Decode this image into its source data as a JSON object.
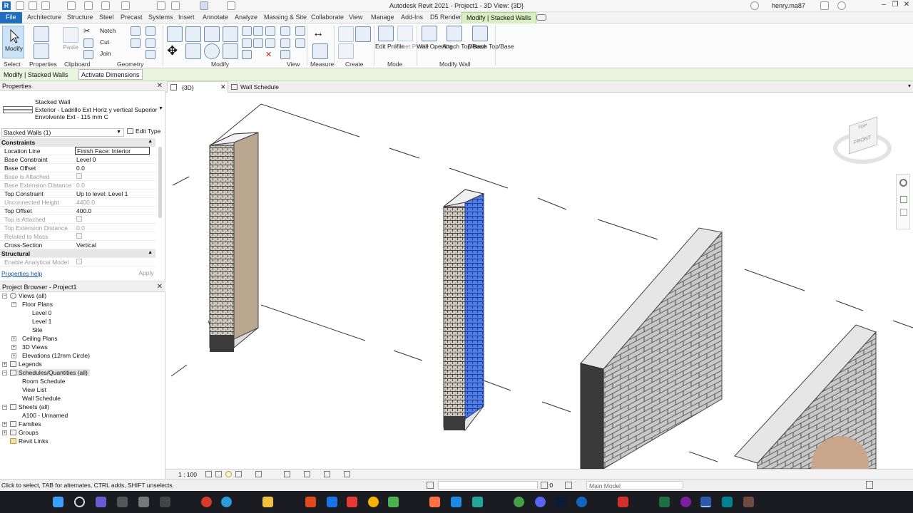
{
  "app": {
    "title": "Autodesk Revit 2021 - Project1 - 3D View: {3D}",
    "user": "henry.ma87"
  },
  "ribbon_tabs": [
    "File",
    "Architecture",
    "Structure",
    "Steel",
    "Precast",
    "Systems",
    "Insert",
    "Annotate",
    "Analyze",
    "Massing & Site",
    "Collaborate",
    "View",
    "Manage",
    "Add-Ins",
    "D5 Render",
    "Modify | Stacked Walls"
  ],
  "ribbon": {
    "modify": "Modify",
    "paste": "Paste",
    "notch": "Notch",
    "cut": "Cut",
    "join": "Join",
    "edit_profile": "Edit Profile",
    "reset_profile": "Reset Profile",
    "wall_opening": "Wall Opening",
    "attach": "Attach Top/Base",
    "detach": "Detach Top/Base",
    "groups": {
      "select": "Select",
      "properties": "Properties",
      "clipboard": "Clipboard",
      "geometry": "Geometry",
      "modify": "Modify",
      "view": "View",
      "measure": "Measure",
      "create": "Create",
      "mode": "Mode",
      "modify_wall": "Modify Wall"
    }
  },
  "context_bar": {
    "label": "Modify | Stacked Walls",
    "button": "Activate Dimensions"
  },
  "properties": {
    "header": "Properties",
    "type_family": "Stacked Wall",
    "type_name_1": "Exterior - Ladrillo Ext Horiz  y vertical Superior",
    "type_name_2": "Envolvente Ext - 115 mm C",
    "selector": "Stacked Walls (1)",
    "edit_type": "Edit Type",
    "help": "Properties help",
    "apply": "Apply",
    "section_constraints": "Constraints",
    "section_structural": "Structural",
    "rows": [
      {
        "key": "Location Line",
        "value": "Finish Face: Interior"
      },
      {
        "key": "Base Constraint",
        "value": "Level 0"
      },
      {
        "key": "Base Offset",
        "value": "0.0"
      },
      {
        "key": "Base is Attached",
        "value": ""
      },
      {
        "key": "Base Extension Distance",
        "value": "0.0"
      },
      {
        "key": "Top Constraint",
        "value": "Up to level: Level 1"
      },
      {
        "key": "Unconnected Height",
        "value": "4400.0"
      },
      {
        "key": "Top Offset",
        "value": "400.0"
      },
      {
        "key": "Top is Attached",
        "value": ""
      },
      {
        "key": "Top Extension Distance",
        "value": "0.0"
      },
      {
        "key": "Related to Mass",
        "value": ""
      },
      {
        "key": "Cross-Section",
        "value": "Vertical"
      }
    ],
    "analytical": "Enable Analytical Model"
  },
  "browser": {
    "header": "Project Browser - Project1",
    "nodes": [
      "Views (all)",
      "Floor Plans",
      "Level 0",
      "Level 1",
      "Site",
      "Ceiling Plans",
      "3D Views",
      "Elevations (12mm Circle)",
      "Legends",
      "Schedules/Quantities (all)",
      "Room Schedule",
      "View List",
      "Wall Schedule",
      "Sheets (all)",
      "A100 - Unnamed",
      "Families",
      "Groups",
      "Revit Links"
    ]
  },
  "view_tabs": [
    "{3D}",
    "Wall Schedule"
  ],
  "view_cube": {
    "top": "TOP",
    "front": "FRONT"
  },
  "view_control": {
    "scale": "1 : 100"
  },
  "status": {
    "message": "Click to select, TAB for alternates, CTRL adds, SHIFT unselects.",
    "zero": ":0",
    "model": "Main Model"
  },
  "colors": {
    "selection_blue": "#3d6fe0",
    "ribbon_context": "#d9efc3",
    "file_tab": "#1f6fbe"
  }
}
